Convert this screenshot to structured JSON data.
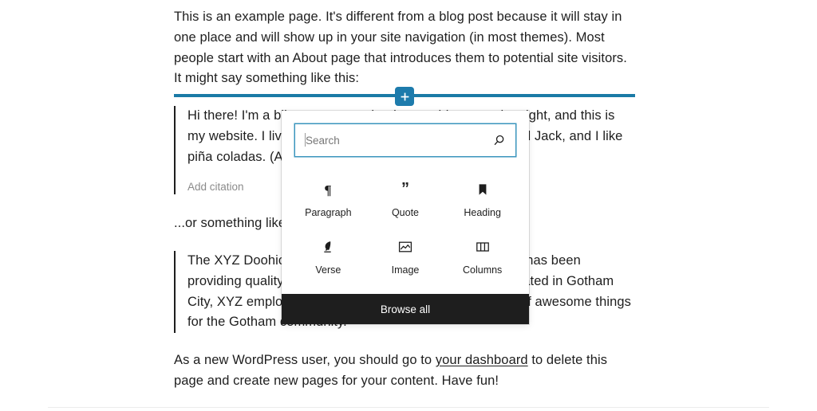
{
  "editor": {
    "intro_paragraph": "This is an example page. It's different from a blog post because it will stay in one place and will show up in your site navigation (in most themes). Most people start with an About page that introduces them to potential site visitors. It might say something like this:",
    "quote_one": "Hi there! I'm a bike messenger by day, aspiring actor by night, and this is my website. I live in Los Angeles, have a great dog named Jack, and I like piña coladas. (And gettin' caught in the rain.)",
    "quote_one_citation_placeholder": "Add citation",
    "or_paragraph": "...or something like this:",
    "quote_two": "The XYZ Doohickey Company was founded in 1971, and has been providing quality doohickeys to the public ever since. Located in Gotham City, XYZ employs over 2,000 people and does all kinds of awesome things for the Gotham community.",
    "final_paragraph_before_link": "As a new WordPress user, you should go to ",
    "final_paragraph_link": "your dashboard",
    "final_paragraph_after_link": " to delete this page and create new pages for your content. Have fun!"
  },
  "inserter": {
    "toggle_label": "+",
    "toggle_icon": "plus-icon",
    "accent_color": "#1d7bac"
  },
  "popover": {
    "search": {
      "placeholder": "Search",
      "value": "",
      "icon": "search-icon"
    },
    "blocks": [
      {
        "label": "Paragraph",
        "icon": "paragraph-icon"
      },
      {
        "label": "Quote",
        "icon": "quote-icon"
      },
      {
        "label": "Heading",
        "icon": "heading-icon"
      },
      {
        "label": "Verse",
        "icon": "verse-icon"
      },
      {
        "label": "Image",
        "icon": "image-icon"
      },
      {
        "label": "Columns",
        "icon": "columns-icon"
      }
    ],
    "browse_all_label": "Browse all",
    "browse_all_background": "#1e1e1e"
  }
}
